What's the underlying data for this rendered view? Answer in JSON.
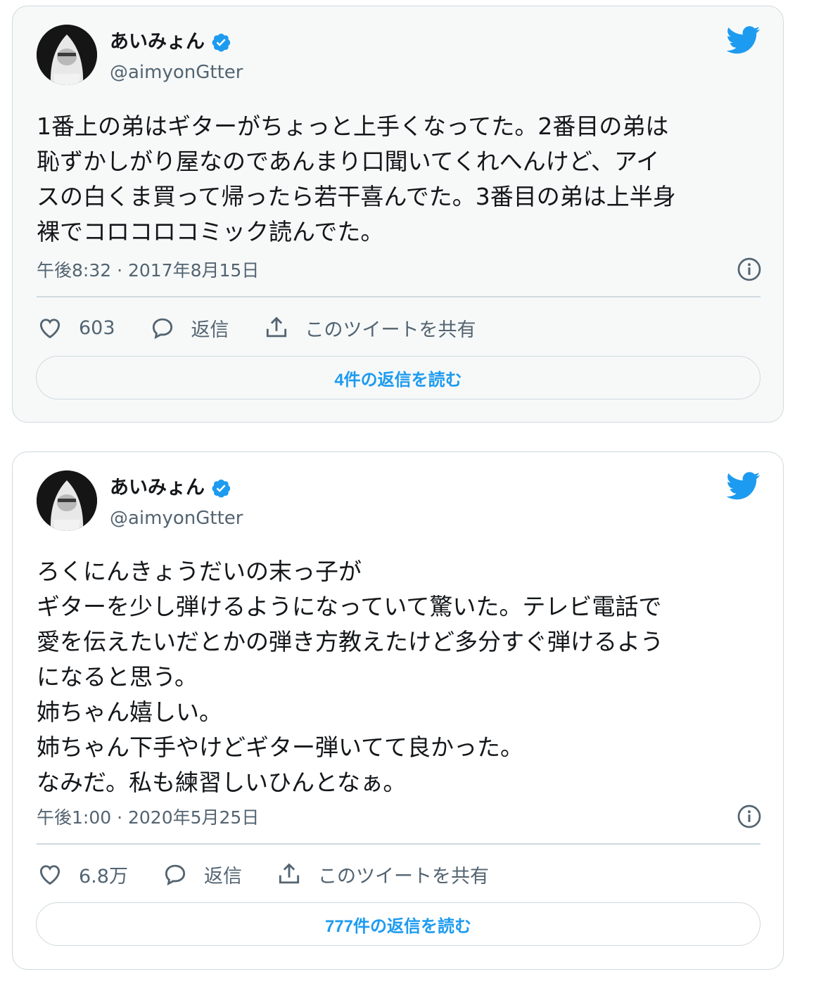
{
  "colors": {
    "accent": "#1d9bf0",
    "secondary_text": "#536471",
    "border": "#cfd9de"
  },
  "tweets": [
    {
      "author_name": "あいみょん",
      "handle": "@aimyonGtter",
      "text": "1番上の弟はギターがちょっと上手くなってた。2番目の弟は\n恥ずかしがり屋なのであんまり口聞いてくれへんけど、アイ\nスの白くま買って帰ったら若干喜んでた。3番目の弟は上半身\n裸でコロコロコミック読んでた。",
      "timestamp": "午後8:32 · 2017年8月15日",
      "likes": "603",
      "reply_label": "返信",
      "share_label": "このツイートを共有",
      "read_replies": "4件の返信を読む"
    },
    {
      "author_name": "あいみょん",
      "handle": "@aimyonGtter",
      "text": "ろくにんきょうだいの末っ子が\nギターを少し弾けるようになっていて驚いた。テレビ電話で\n愛を伝えたいだとかの弾き方教えたけど多分すぐ弾けるよう\nになると思う。\n姉ちゃん嬉しい。\n姉ちゃん下手やけどギター弾いてて良かった。\nなみだ。私も練習しいひんとなぁ。",
      "timestamp": "午後1:00 · 2020年5月25日",
      "likes": "6.8万",
      "reply_label": "返信",
      "share_label": "このツイートを共有",
      "read_replies": "777件の返信を読む"
    }
  ]
}
